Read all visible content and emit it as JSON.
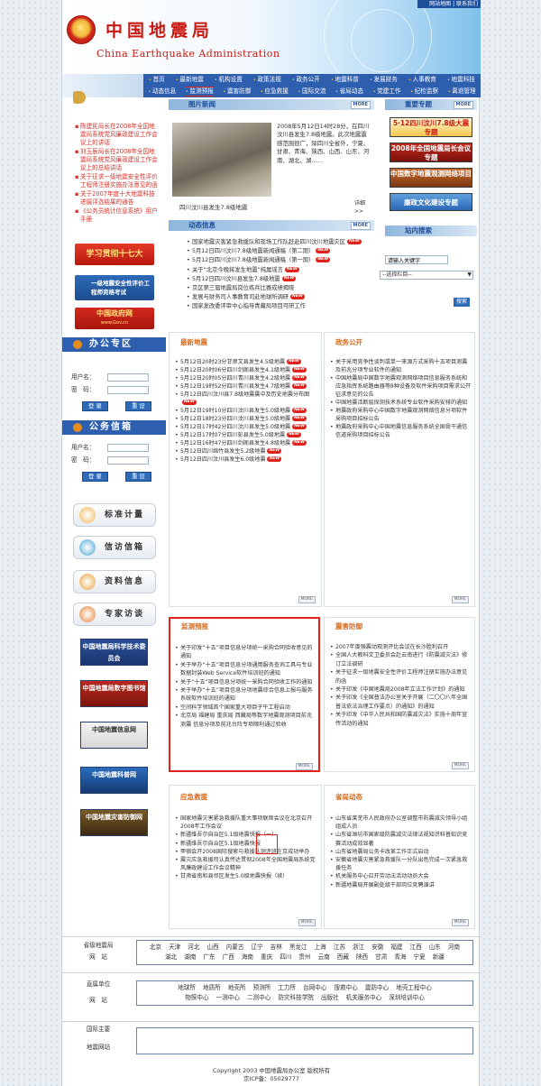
{
  "header": {
    "top_links": "网站地图 | 联系我们",
    "title_cn": "中国地震局",
    "title_en": "China Earthquake  Administration"
  },
  "nav": {
    "row1": [
      "首页",
      "最新地震",
      "机构设置",
      "政策法规",
      "政务公开",
      "地震科普",
      "发展财务",
      "人事教育",
      "地震科技"
    ],
    "row2": [
      "动态信息",
      "监测预报",
      "震害防御",
      "应急救援",
      "国际交流",
      "省局动态",
      "党建工作",
      "纪检监察",
      "离退管理"
    ]
  },
  "left_news": [
    "陈建民局长在2008年全国地震局系统党风廉政建设工作会议上的讲话",
    "刘玉辰局长在2008年全国地震局系统党风廉政建设工作会议上的总结讲话",
    "关于征求一级地震安全性评价工程师注册实施办法意见的函",
    "关于2007年度十大地震科技进展评选结果的通告",
    "《公务员统计信息系统》用户手册"
  ],
  "left_banners": {
    "study": "学习贯彻十七大",
    "cert": "一级地震安全性评价工程师资格考试",
    "gov": "中国政府网",
    "gov_sub": "www.Gov.cn"
  },
  "office": {
    "title": "办公专区",
    "username_label": "用户名：",
    "password_label": "密　码：",
    "login": "登 录",
    "reset": "重 设"
  },
  "mail": {
    "title": "公务信箱",
    "username_label": "用户名：",
    "password_label": "密　码：",
    "login": "登 录",
    "reset": "重 设"
  },
  "services": [
    "标准计量",
    "信访信箱",
    "资料信息",
    "专家访谈"
  ],
  "link_banners": [
    "中国地震局科学技术委员会",
    "中国地震局数字图书馆",
    "中国地震信息网",
    "中国地震科普网",
    "中国地震灾害防御网"
  ],
  "photo_news": {
    "title": "图片新闻",
    "more": "MORE",
    "text": "2008年5月12日14时28分，在四川汶川县发生7.8级地震。此次地震震感范围很广，除四川全省外，宁夏、甘肃、青海、陕西、山西、山东、河南、湖北、湖……",
    "detail": "详细>>",
    "caption": "四川汶川县发生7.8级地震"
  },
  "dynamic": {
    "title": "动态信息",
    "more": "MORE",
    "items": [
      {
        "text": "国家地震灾害紧急救援队和现场工作队赶赴四川汶川地震灾区",
        "new": true
      },
      {
        "text": "5月12日四川汶川7.8级地震新闻通稿（第二期）",
        "new": true
      },
      {
        "text": "5月12日四川汶川7.8级地震新闻通稿（第一期）",
        "new": true
      },
      {
        "text": "关于“北京今晚将发生地震”纯属谣言",
        "new": true
      },
      {
        "text": "5月12日四川汶川县发生7.8级地震",
        "new": true
      },
      {
        "text": "京区第三届地震局岗位练兵比赛成绩揭晓",
        "new": false
      },
      {
        "text": "发展与财务司人事教育司赴地球所调研",
        "new": true
      },
      {
        "text": "国家发改委评审中心指导青藏局项目可研工作",
        "new": false
      }
    ]
  },
  "important": {
    "title": "重要专题",
    "b1": "5·12四川汶川7.8级大震专题",
    "b2": "2008年全国地震局长会议专题",
    "b3": "中国数字地震观测网络项目",
    "b4": "廉政文化建设专题"
  },
  "search": {
    "title": "站内搜索",
    "placeholder": "请输入关键字",
    "select": "--选择栏目--",
    "button": "搜索"
  },
  "latest_quakes": {
    "title": "最新地震",
    "more": "MORE",
    "items": [
      "5月12日20时23分甘肃文县发生4.5级地震",
      "5月12日20时06分四川剑阁县发生4.1级地震",
      "5月12日20时05分四川青川县发生4.2级地震",
      "5月12日19时52分四川青川县发生4.7级地震",
      "5月12日四川汶川县7.8级地震震中及历史地震分布图",
      "5月12日19时10分四川汶川县发生5.0级地震",
      "5月12日18时23分四川汶川县发生5.0级地震",
      "5月12日17时42分四川汶川县发生5.0级地震",
      "5月12日17时07分四川彭县发生5.0级地震",
      "5月12日16时47分四川剑阁县发生4.8级地震",
      "5月12日四川绵竹县发生5.2级地震",
      "5月12日四川汶川县发生6.0级地震"
    ]
  },
  "gov_open": {
    "title": "政务公开",
    "more": "MORE",
    "items": [
      "关于采用竞争性谈判或单一来源方式采购十五项目测震及前兆分项专业软件的通知",
      "中国地震局中国数字地震观测网络项目信息服务系统和应急指挥系统路由器等8种设备及软件采购项目需求公开征求意见的公告",
      "中国地震活断层探测技术系统专业软件采购安排的通知",
      "地震政府采购中心中国数字地震观测网络信息分项软件采购项目招标公告",
      "地震政府采购中心中国地震信息服务系统全国骨干通信信道采购项目招标公告"
    ]
  },
  "monitor": {
    "title": "监测预报",
    "more": "MORE",
    "items": [
      "关于印发“十五”项目信息分项统一采购合同验收意见的通知",
      "关于举办“十五”项目信息分项通用服务查询工具与专业数据封装Web Service软件培训班的通知",
      "关于“十五”项目信息分项统一采购合同验收工作的通知",
      "关于举办“十五”项目信息分项地震综合信息上报与服务系统软件培训班的通知",
      "空间科学领域首个国家重大项目子午工程启动",
      "北京局 福建局 重庆局 西藏局等数字地震观测项目前兆 测震 信息分项及前兆台阵专项顺利通过验收"
    ]
  },
  "defense": {
    "title": "震害防御",
    "more": "MORE",
    "items": [
      "2007年度强震动观测评比会议在长沙胜利召开",
      "全国人大教科文卫委员会赴云南进行《防震减灾法》修订立法调研",
      "关于征求一级地震安全性评价工程师注册实施办法意见的函",
      "关于印发《中国地震局2008年立法工作计划》的通知",
      "关于印发《全国普法办公室关于开展（二〇〇八年全国普法依法治理工作要点）的通知》的通知",
      "关于印发《中华人民共和国防震减灾法》实施十周年宣传活动的通知"
    ]
  },
  "rescue": {
    "title": "应急救援",
    "more": "MORE",
    "items": [
      "国家地震灾害紧急救援队重大事项联席会议在北京召开2008年工作会议",
      "新疆维吾尔自治区5.1级地震快报（一）",
      "新疆维吾尔自治区5.1级地震快报",
      "甲宿会开2008国际搜索与救援队测评班在京成功举办",
      "震灾应急救援司认真传达贯彻2008年全国地震局系统党风廉政建设工作会议精神",
      "甘肃省南和县邻区发生5.0级地震快报（续）"
    ]
  },
  "province": {
    "title": "省局动态",
    "more": "MORE",
    "items": [
      "山东省莱芜市人民政府办公室调整市防震减灾领导小组组成人员",
      "山东省潍坊市国家级防震减灾法律法规知识科普知识竞赛活动成效显著",
      "山东省地震局公务卡改革工作正式启动",
      "安徽省地震灾害紧急救援队一分队出色完成一次紧急救援任务",
      "机关服务中心召开劳动法活动动员大会",
      "新疆地震局开展副处级干部岗位竞聘演讲"
    ]
  },
  "provincial_sites": {
    "label1": "省级地震局",
    "label2": "网　站",
    "row1": [
      "北京",
      "天津",
      "河北",
      "山西",
      "内蒙古",
      "辽宁",
      "吉林",
      "黑龙江",
      "上海",
      "江苏",
      "浙江",
      "安徽",
      "福建",
      "江西",
      "山东",
      "河南"
    ],
    "row2": [
      "湖北",
      "湖南",
      "广东",
      "广西",
      "海南",
      "重庆",
      "四川",
      "贵州",
      "云南",
      "西藏",
      "陕西",
      "甘肃",
      "青海",
      "宁夏",
      "新疆"
    ]
  },
  "direct_units": {
    "label1": "直属单位",
    "label2": "网　站",
    "row1": [
      "地球所",
      "地质所",
      "地壳所",
      "预测所",
      "工力所",
      "台网中心",
      "搜救中心",
      "震防中心",
      "地壳工程中心"
    ],
    "row2": [
      "物探中心",
      "一测中心",
      "二测中心",
      "防灾科技学院",
      "出版社",
      "机关服务中心",
      "深圳培训中心"
    ]
  },
  "intl_sites": {
    "label1": "国际主要",
    "label2": "地震网站"
  },
  "footer": {
    "copyright": "Copyright 2003  中国地震局办公室  版权所有",
    "icp": "京ICP备：05029777"
  }
}
